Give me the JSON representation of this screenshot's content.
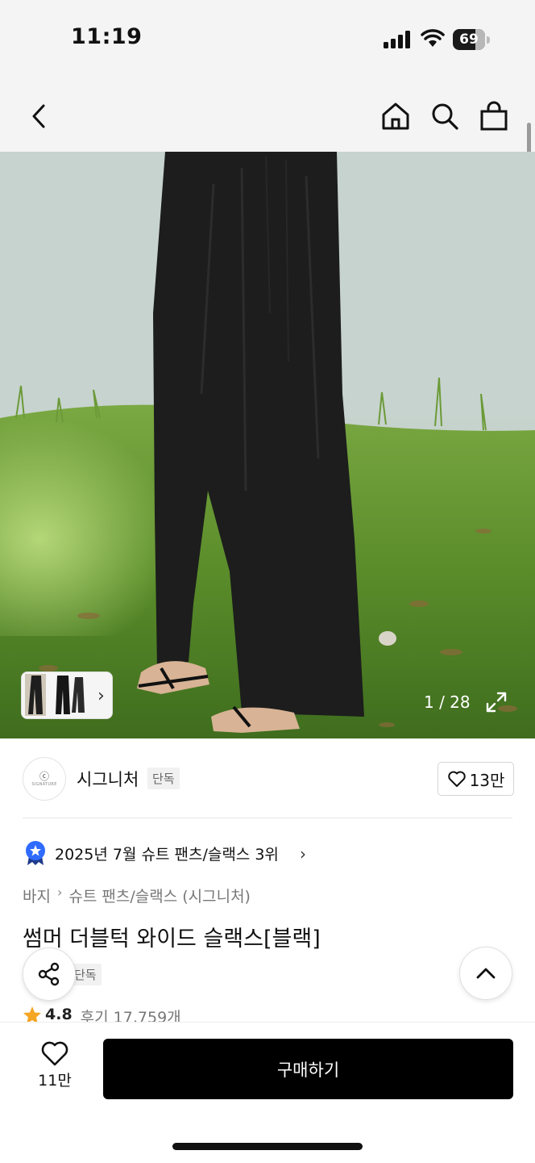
{
  "status_bar": {
    "time": "11:19",
    "battery_level": "69",
    "battery_fraction": 0.69
  },
  "nav": {
    "back_icon": "chevron-left-icon",
    "home_icon": "home-icon",
    "search_icon": "search-icon",
    "cart_icon": "shopping-bag-icon"
  },
  "gallery": {
    "counter": "1 / 28",
    "thumb_arrow": "›"
  },
  "brand": {
    "logo_mark": "ⓒ",
    "logo_text": "SIGNATURE",
    "name": "시그니처",
    "badge": "단독",
    "likes": "13만"
  },
  "ranking": {
    "text": "2025년 7월 슈트 팬츠/슬랙스 3위",
    "chevron": "›"
  },
  "breadcrumb": {
    "category": "바지",
    "separator": "›",
    "subcategory": "슈트 팬츠/슬랙스 (시그니처)"
  },
  "product": {
    "title": "썸머 더블턱 와이드 슬랙스[블랙]",
    "badge": "단독",
    "rating": "4.8",
    "reviews": "후기 17,759개"
  },
  "bottom_bar": {
    "wish_count": "11만",
    "buy_label": "구매하기"
  },
  "colors": {
    "accent": "#000000",
    "rank_badge": "#2f6bff",
    "star": "#f5a623"
  }
}
